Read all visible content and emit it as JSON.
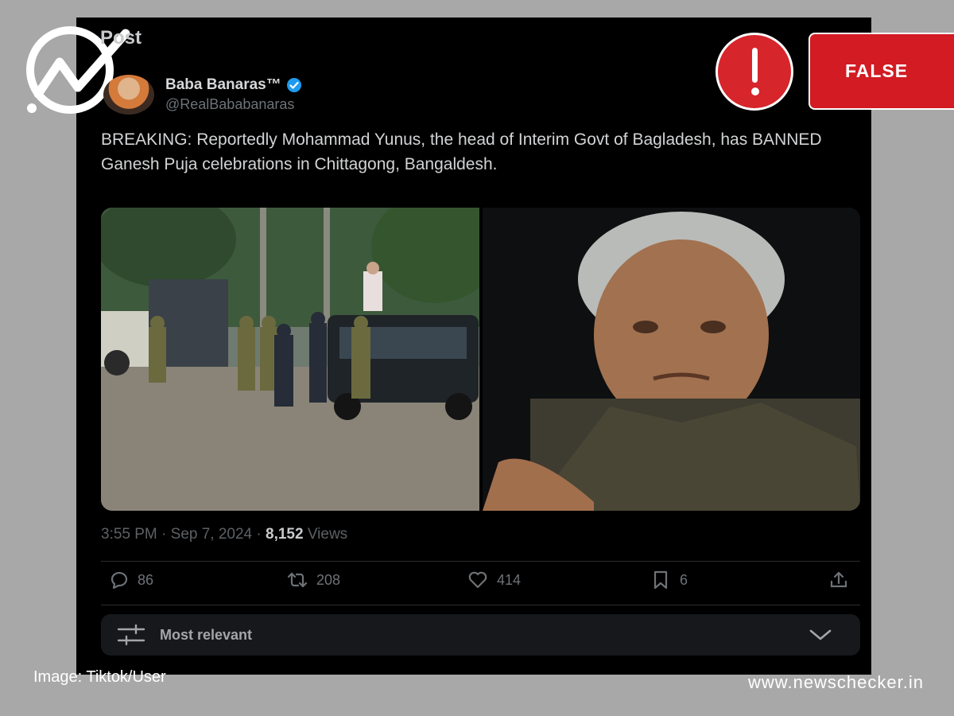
{
  "header": {
    "title": "Post"
  },
  "author": {
    "name": "Baba Banaras™",
    "handle": "@RealBababanaras"
  },
  "tweet": {
    "text": "BREAKING: Reportedly Mohammad Yunus, the head of Interim Govt of Bagladesh, has BANNED Ganesh Puja celebrations in Chittagong, Bangaldesh.",
    "time": "3:55 PM · Sep 7, 2024 · ",
    "views_count": "8,152",
    "views_label": " Views"
  },
  "actions": {
    "replies": "86",
    "reposts": "208",
    "likes": "414",
    "bookmarks": "6"
  },
  "sort": {
    "label": "Most relevant"
  },
  "verdict": {
    "label": "FALSE"
  },
  "credit": "Image: Tiktok/User",
  "site": "www.newschecker.in",
  "colors": {
    "verdict_red": "#d21b22",
    "verified_blue": "#1d9bf0",
    "background": "#a8a8a8"
  }
}
